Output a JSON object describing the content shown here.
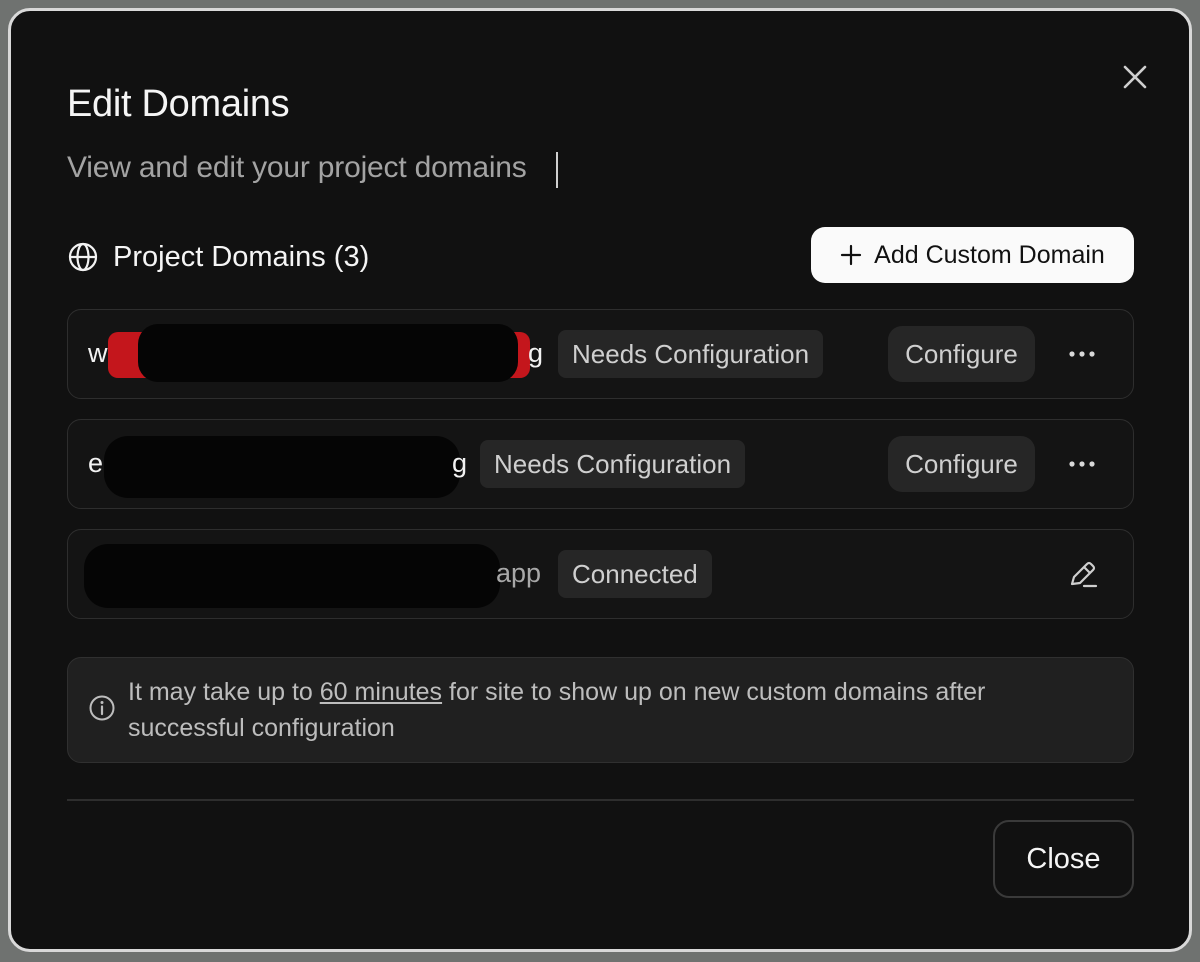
{
  "dialog": {
    "title": "Edit Domains",
    "subtitle": "View and edit your project domains",
    "close_icon": "close-icon"
  },
  "section": {
    "title": "Project Domains (3)",
    "icon": "globe-icon",
    "add_button_label": "Add Custom Domain",
    "add_button_icon": "plus-icon"
  },
  "domains": [
    {
      "name_prefix": "w",
      "name_suffix": "g",
      "status": "Needs Configuration",
      "action": "Configure",
      "more_icon": "more-horizontal-icon"
    },
    {
      "name_prefix": "e",
      "name_suffix": "g",
      "status": "Needs Configuration",
      "action": "Configure",
      "more_icon": "more-horizontal-icon"
    },
    {
      "name_prefix": "",
      "name_suffix": "app",
      "status": "Connected",
      "action_icon": "edit-pencil-icon"
    }
  ],
  "info": {
    "icon": "info-icon",
    "text_before": "It may take up to ",
    "link_text": "60 minutes",
    "text_after": " for site to show up on new custom domains after successful configuration"
  },
  "footer": {
    "close_label": "Close"
  }
}
